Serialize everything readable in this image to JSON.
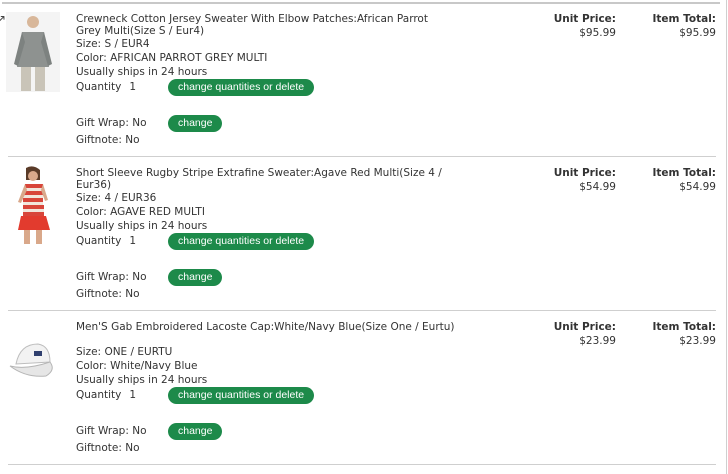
{
  "labels": {
    "size": "Size:",
    "color": "Color:",
    "quantity": "Quantity",
    "gift_wrap": "Gift Wrap:",
    "giftnote": "Giftnote:",
    "unit_price": "Unit Price:",
    "item_total": "Item Total:",
    "change_qty_button": "change quantities or delete",
    "change_button": "change"
  },
  "items": [
    {
      "name": "Crewneck Cotton Jersey Sweater With Elbow Patches:African Parrot Grey Multi(Size S / Eur4)",
      "size": "S / EUR4",
      "color": "AFRICAN PARROT GREY MULTI",
      "shipping": "Usually ships in 24 hours",
      "quantity": "1",
      "gift_wrap": "No",
      "giftnote": "No",
      "unit_price": "$95.99",
      "item_total": "$95.99",
      "image_icon": "grey-sweater-image"
    },
    {
      "name": "Short Sleeve Rugby Stripe Extrafine Sweater:Agave Red Multi(Size 4 / Eur36)",
      "size": "4 / EUR36",
      "color": "AGAVE RED MULTI",
      "shipping": "Usually ships in 24 hours",
      "quantity": "1",
      "gift_wrap": "No",
      "giftnote": "No",
      "unit_price": "$54.99",
      "item_total": "$54.99",
      "image_icon": "striped-sweater-image"
    },
    {
      "name": "Men'S Gab Embroidered Lacoste Cap:White/Navy Blue(Size One / Eurtu)",
      "size": "ONE / EURTU",
      "color": "White/Navy Blue",
      "shipping": "Usually ships in 24 hours",
      "quantity": "1",
      "gift_wrap": "No",
      "giftnote": "No",
      "unit_price": "$23.99",
      "item_total": "$23.99",
      "image_icon": "white-cap-image"
    }
  ]
}
